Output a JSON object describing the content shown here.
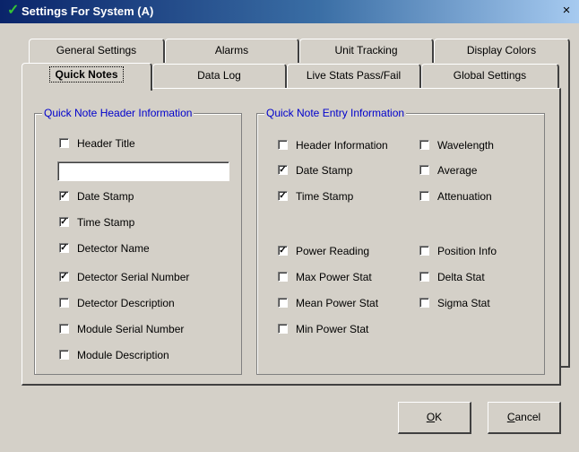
{
  "window": {
    "title": "Settings For System (A)",
    "close_glyph": "×",
    "check_icon": "check-icon"
  },
  "tabs": {
    "row1": [
      {
        "label": "General Settings"
      },
      {
        "label": "Alarms"
      },
      {
        "label": "Unit Tracking"
      },
      {
        "label": "Display Colors"
      }
    ],
    "row2": [
      {
        "label": "Quick Notes",
        "active": true
      },
      {
        "label": "Data Log"
      },
      {
        "label": "Live Stats Pass/Fail"
      },
      {
        "label": "Global Settings"
      }
    ]
  },
  "header_group": {
    "title": "Quick Note Header Information",
    "header_title_value": "",
    "items": [
      {
        "label": "Header Title",
        "checked": false
      },
      {
        "label": "Date Stamp",
        "checked": true
      },
      {
        "label": "Time Stamp",
        "checked": true
      },
      {
        "label": "Detector Name",
        "checked": true
      },
      {
        "label": "Detector Serial Number",
        "checked": true
      },
      {
        "label": "Detector Description",
        "checked": false
      },
      {
        "label": "Module Serial Number",
        "checked": false
      },
      {
        "label": "Module Description",
        "checked": false
      }
    ]
  },
  "entry_group": {
    "title": "Quick Note Entry Information",
    "left": [
      {
        "label": "Header Information",
        "checked": false
      },
      {
        "label": "Date Stamp",
        "checked": true
      },
      {
        "label": "Time Stamp",
        "checked": true
      },
      {
        "label": "Power Reading",
        "checked": true
      },
      {
        "label": "Max Power Stat",
        "checked": false
      },
      {
        "label": "Mean Power Stat",
        "checked": false
      },
      {
        "label": "Min Power Stat",
        "checked": false
      }
    ],
    "right": [
      {
        "label": "Wavelength",
        "checked": false
      },
      {
        "label": "Average",
        "checked": false
      },
      {
        "label": "Attenuation",
        "checked": false
      },
      {
        "label": "Position Info",
        "checked": false
      },
      {
        "label": "Delta Stat",
        "checked": false
      },
      {
        "label": "Sigma Stat",
        "checked": false
      }
    ]
  },
  "buttons": {
    "ok": {
      "mnemonic": "O",
      "rest": "K"
    },
    "cancel": {
      "mnemonic": "C",
      "rest": "ancel"
    }
  },
  "check_mark": "✓"
}
